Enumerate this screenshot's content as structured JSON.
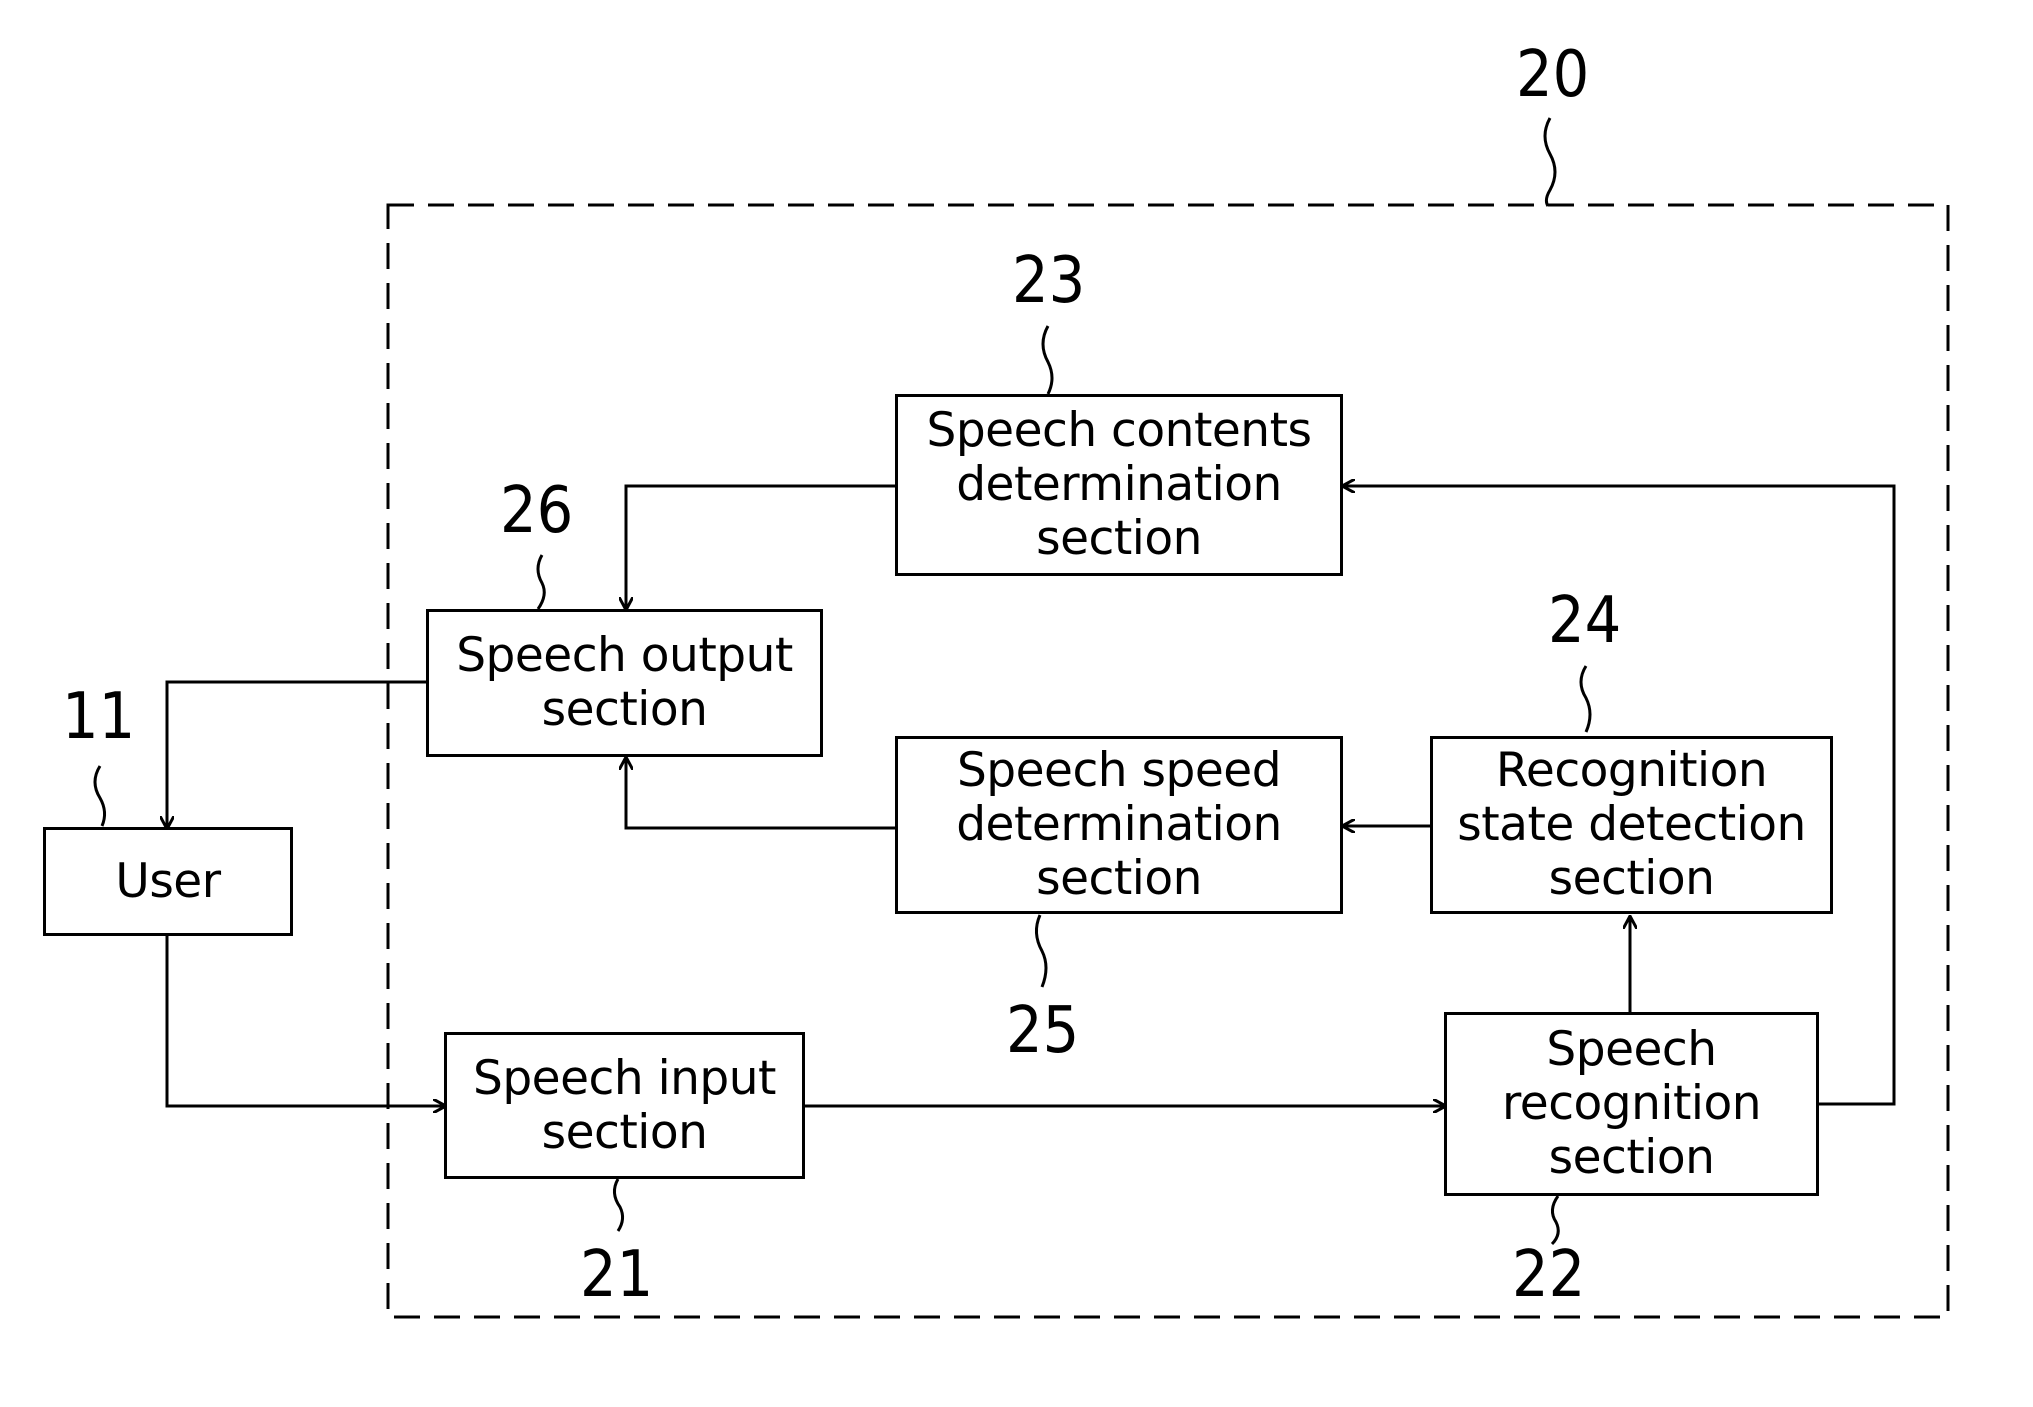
{
  "diagram": {
    "system_label": "20",
    "nodes": [
      {
        "id": "user",
        "ref": "11",
        "label": "User"
      },
      {
        "id": "speech-input",
        "ref": "21",
        "label": "Speech input\nsection"
      },
      {
        "id": "speech-recognition",
        "ref": "22",
        "label": "Speech\nrecognition\nsection"
      },
      {
        "id": "speech-contents",
        "ref": "23",
        "label": "Speech contents\ndetermination\nsection"
      },
      {
        "id": "recognition-state",
        "ref": "24",
        "label": "Recognition\nstate detection\nsection"
      },
      {
        "id": "speech-speed",
        "ref": "25",
        "label": "Speech speed\ndetermination\nsection"
      },
      {
        "id": "speech-output",
        "ref": "26",
        "label": "Speech output\nsection"
      }
    ],
    "edges": [
      {
        "from": "user",
        "to": "speech-input"
      },
      {
        "from": "speech-input",
        "to": "speech-recognition"
      },
      {
        "from": "speech-recognition",
        "to": "recognition-state"
      },
      {
        "from": "speech-recognition",
        "to": "speech-contents"
      },
      {
        "from": "recognition-state",
        "to": "speech-speed"
      },
      {
        "from": "speech-speed",
        "to": "speech-output"
      },
      {
        "from": "speech-contents",
        "to": "speech-output"
      },
      {
        "from": "speech-output",
        "to": "user"
      }
    ]
  }
}
